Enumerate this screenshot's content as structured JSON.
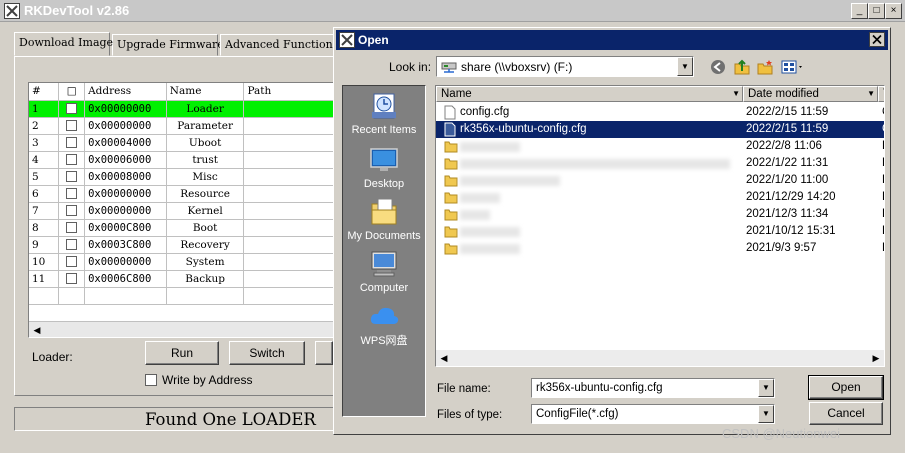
{
  "main": {
    "title": "RKDevTool v2.86",
    "window_controls": {
      "minimize": "_",
      "maximize": "□",
      "close": "×"
    },
    "tabs": [
      {
        "label": "Download Image"
      },
      {
        "label": "Upgrade Firmware"
      },
      {
        "label": "Advanced Function"
      }
    ],
    "grid": {
      "headers": {
        "num": "#",
        "check": "□",
        "address": "Address",
        "name": "Name",
        "path": "Path"
      },
      "rows": [
        {
          "num": "1",
          "address": "0x00000000",
          "name": "Loader",
          "path": ""
        },
        {
          "num": "2",
          "address": "0x00000000",
          "name": "Parameter",
          "path": ""
        },
        {
          "num": "3",
          "address": "0x00004000",
          "name": "Uboot",
          "path": ""
        },
        {
          "num": "4",
          "address": "0x00006000",
          "name": "trust",
          "path": ""
        },
        {
          "num": "5",
          "address": "0x00008000",
          "name": "Misc",
          "path": ""
        },
        {
          "num": "6",
          "address": "0x00000000",
          "name": "Resource",
          "path": ""
        },
        {
          "num": "7",
          "address": "0x00000000",
          "name": "Kernel",
          "path": ""
        },
        {
          "num": "8",
          "address": "0x0000C800",
          "name": "Boot",
          "path": ""
        },
        {
          "num": "9",
          "address": "0x0003C800",
          "name": "Recovery",
          "path": ""
        },
        {
          "num": "10",
          "address": "0x00000000",
          "name": "System",
          "path": ""
        },
        {
          "num": "11",
          "address": "0x0006C800",
          "name": "Backup",
          "path": ""
        }
      ]
    },
    "loader_label": "Loader:",
    "run_label": "Run",
    "switch_label": "Switch",
    "write_by_address_label": "Write by Address",
    "status_text": "Found One LOADER"
  },
  "dialog": {
    "title": "Open",
    "look_in_label": "Look in:",
    "look_in_value": "share (\\\\vboxsrv) (F:)",
    "places": [
      {
        "label": "Recent Items",
        "icon": "recent-items-icon"
      },
      {
        "label": "Desktop",
        "icon": "desktop-icon"
      },
      {
        "label": "My Documents",
        "icon": "my-documents-icon"
      },
      {
        "label": "Computer",
        "icon": "computer-icon"
      },
      {
        "label": "WPS网盘",
        "icon": "wps-cloud-icon"
      }
    ],
    "columns": {
      "name": "Name",
      "date": "Date modified",
      "type": "T"
    },
    "files": [
      {
        "name": "config.cfg",
        "date": "2022/2/15 11:59",
        "type": "C",
        "kind": "file"
      },
      {
        "name": "rk356x-ubuntu-config.cfg",
        "date": "2022/2/15 11:59",
        "type": "C",
        "kind": "file",
        "selected": true
      },
      {
        "name": "",
        "date": "2022/2/8 11:06",
        "type": "F",
        "kind": "folder"
      },
      {
        "name": "",
        "date": "2022/1/22 11:31",
        "type": "F",
        "kind": "folder"
      },
      {
        "name": "",
        "date": "2022/1/20 11:00",
        "type": "F",
        "kind": "folder"
      },
      {
        "name": "",
        "date": "2021/12/29 14:20",
        "type": "F",
        "kind": "folder"
      },
      {
        "name": "",
        "date": "2021/12/3 11:34",
        "type": "F",
        "kind": "folder"
      },
      {
        "name": "",
        "date": "2021/10/12 15:31",
        "type": "F",
        "kind": "folder"
      },
      {
        "name": "",
        "date": "2021/9/3 9:57",
        "type": "F",
        "kind": "folder"
      }
    ],
    "file_name_label": "File name:",
    "file_name_value": "rk356x-ubuntu-config.cfg",
    "file_type_label": "Files of type:",
    "file_type_value": "ConfigFile(*.cfg)",
    "open_label": "Open",
    "cancel_label": "Cancel"
  },
  "watermark": "CSDN @Neutionwei",
  "colors": {
    "selected_row": "#00f000",
    "dialog_titlebar": "#0a246a",
    "places_bar": "#808080"
  }
}
